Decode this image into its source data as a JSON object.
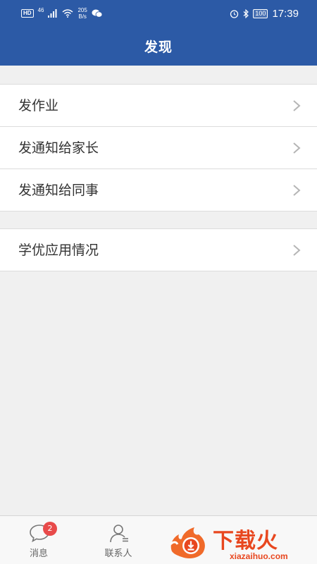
{
  "status_bar": {
    "hd": "HD",
    "network": "46",
    "speed_value": "205",
    "speed_unit": "B/s",
    "battery": "100",
    "time": "17:39"
  },
  "header": {
    "title": "发现"
  },
  "menu": {
    "group1": [
      {
        "label": "发作业"
      },
      {
        "label": "发通知给家长"
      },
      {
        "label": "发通知给同事"
      }
    ],
    "group2": [
      {
        "label": "学优应用情况"
      }
    ]
  },
  "tabbar": {
    "messages": {
      "label": "消息",
      "badge": "2"
    },
    "contacts": {
      "label": "联系人"
    }
  },
  "watermark": {
    "title": "下载火",
    "url": "xiazaihuo.com"
  },
  "colors": {
    "primary": "#2c5aa6",
    "badge": "#e84a4a",
    "watermark": "#e8471f"
  }
}
